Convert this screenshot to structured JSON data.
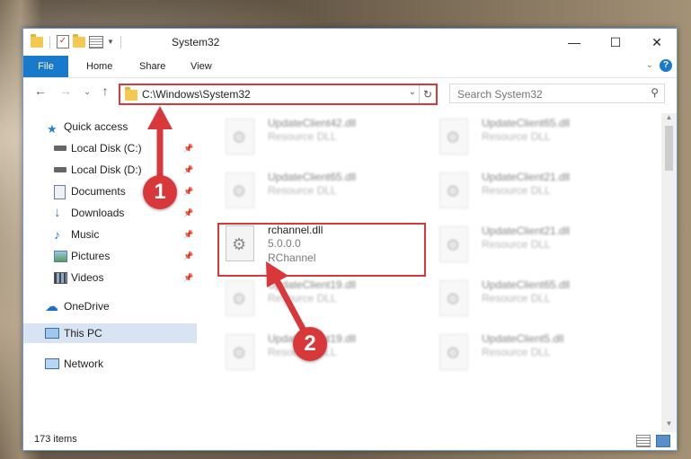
{
  "window": {
    "title": "System32",
    "controls": {
      "minimize": "—",
      "maximize": "☐",
      "close": "✕"
    }
  },
  "ribbon": {
    "tabs": [
      "File",
      "Home",
      "Share",
      "View"
    ],
    "help": "?"
  },
  "nav": {
    "address_path": "C:\\Windows\\System32",
    "search_placeholder": "Search System32"
  },
  "sidebar": {
    "items": [
      {
        "label": "Quick access",
        "icon": "star-icon"
      },
      {
        "label": "Local Disk (C:)",
        "icon": "drive-icon"
      },
      {
        "label": "Local Disk (D:)",
        "icon": "drive-icon"
      },
      {
        "label": "Documents",
        "icon": "documents-icon"
      },
      {
        "label": "Downloads",
        "icon": "download-icon"
      },
      {
        "label": "Music",
        "icon": "music-icon"
      },
      {
        "label": "Pictures",
        "icon": "pictures-icon"
      },
      {
        "label": "Videos",
        "icon": "videos-icon"
      },
      {
        "label": "OneDrive",
        "icon": "cloud-icon"
      },
      {
        "label": "This PC",
        "icon": "computer-icon"
      },
      {
        "label": "Network",
        "icon": "network-icon"
      }
    ]
  },
  "files": [
    {
      "name": "UpdateClient42.dll",
      "desc": "Resource DLL"
    },
    {
      "name": "UpdateClient65.dll",
      "desc": "Resource DLL"
    },
    {
      "name": "UpdateClient65.dll",
      "desc": "Resource DLL"
    },
    {
      "name": "UpdateClient21.dll",
      "desc": "Resource DLL"
    },
    {
      "name": "rchannel.dll",
      "version": "5.0.0.0",
      "desc": "RChannel"
    },
    {
      "name": "UpdateClient21.dll",
      "desc": "Resource DLL"
    },
    {
      "name": "UpdateClient19.dll",
      "desc": "Resource DLL"
    },
    {
      "name": "UpdateClient65.dll",
      "desc": "Resource DLL"
    },
    {
      "name": "UpdateClient19.dll",
      "desc": "Resource DLL"
    },
    {
      "name": "UpdateClient5.dll",
      "desc": "Resource DLL"
    }
  ],
  "status": {
    "count": "173 items"
  },
  "annotations": {
    "step1": "1",
    "step2": "2"
  },
  "colors": {
    "accent": "#1979ca",
    "highlight": "#d9383a"
  }
}
